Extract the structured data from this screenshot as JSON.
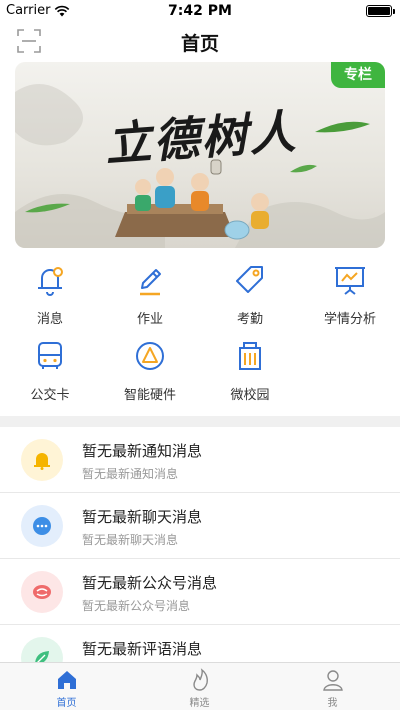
{
  "status_bar": {
    "carrier": "Carrier",
    "time": "7:42 PM"
  },
  "nav": {
    "title": "首页",
    "scan_icon": "scan-icon"
  },
  "banner": {
    "tag": "专栏",
    "title": "立德树人"
  },
  "grid": [
    {
      "label": "消息",
      "icon": "bell-icon"
    },
    {
      "label": "作业",
      "icon": "pencil-icon"
    },
    {
      "label": "考勤",
      "icon": "tag-icon"
    },
    {
      "label": "学情分析",
      "icon": "presentation-chart-icon"
    },
    {
      "label": "公交卡",
      "icon": "bus-icon"
    },
    {
      "label": "智能硬件",
      "icon": "device-icon"
    },
    {
      "label": "微校园",
      "icon": "building-icon"
    }
  ],
  "messages": [
    {
      "title": "暂无最新通知消息",
      "subtitle": "暂无最新通知消息",
      "icon": "bell-icon",
      "color": "#f5b400",
      "bg": "#fff4d6"
    },
    {
      "title": "暂无最新聊天消息",
      "subtitle": "暂无最新聊天消息",
      "icon": "chat-icon",
      "color": "#3d8ee6",
      "bg": "#e3eefc"
    },
    {
      "title": "暂无最新公众号消息",
      "subtitle": "暂无最新公众号消息",
      "icon": "official-account-icon",
      "color": "#ef6b6b",
      "bg": "#fde6e6"
    },
    {
      "title": "暂无最新评语消息",
      "subtitle": "",
      "icon": "leaf-icon",
      "color": "#3fbf7f",
      "bg": "#e3f6ec"
    }
  ],
  "tabs": [
    {
      "label": "首页",
      "icon": "home-icon",
      "active": true
    },
    {
      "label": "精选",
      "icon": "flame-icon",
      "active": false
    },
    {
      "label": "我",
      "icon": "user-icon",
      "active": false
    }
  ],
  "colors": {
    "accent": "#2f6fd6",
    "tag_green": "#3fb53f",
    "icon_orange": "#f5a623"
  }
}
